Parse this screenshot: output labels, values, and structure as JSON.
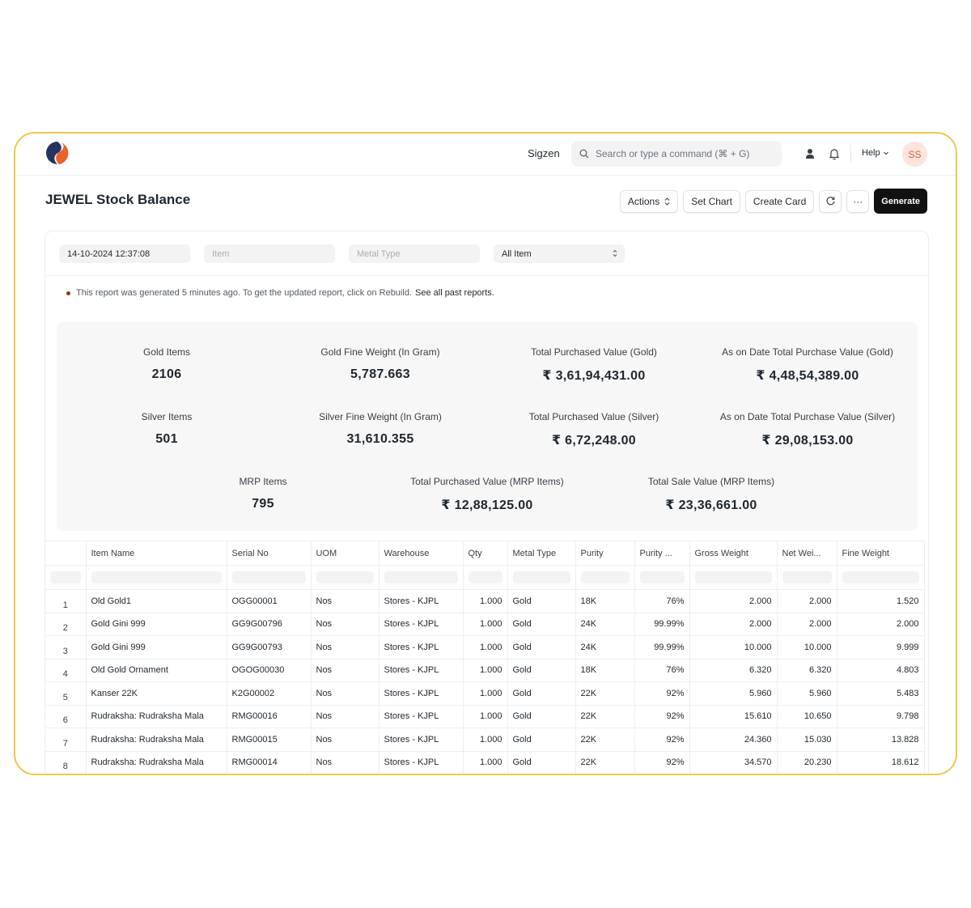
{
  "nav": {
    "brand": "Sigzen",
    "search_placeholder": "Search or type a command (⌘ + G)",
    "help": "Help",
    "avatar_initials": "SS"
  },
  "page": {
    "title": "JEWEL Stock Balance"
  },
  "toolbar": {
    "actions": "Actions",
    "set_chart": "Set Chart",
    "create_card": "Create Card",
    "more": "···",
    "generate": "Generate"
  },
  "filters": {
    "date": "14-10-2024 12:37:08",
    "item_placeholder": "Item",
    "metal_type_placeholder": "Metal Type",
    "item_scope": "All Item"
  },
  "notice": {
    "text": "This report was generated 5 minutes ago. To get the updated report, click on Rebuild.",
    "link": "See all past reports."
  },
  "summary": [
    {
      "label": "Gold Items",
      "value": "2106"
    },
    {
      "label": "Gold Fine Weight (In Gram)",
      "value": "5,787.663"
    },
    {
      "label": "Total Purchased Value (Gold)",
      "value": "₹ 3,61,94,431.00"
    },
    {
      "label": "As on Date Total Purchase Value (Gold)",
      "value": "₹ 4,48,54,389.00"
    },
    {
      "label": "Silver Items",
      "value": "501"
    },
    {
      "label": "Silver Fine Weight (In Gram)",
      "value": "31,610.355"
    },
    {
      "label": "Total Purchased Value (Silver)",
      "value": "₹ 6,72,248.00"
    },
    {
      "label": "As on Date Total Purchase Value (Silver)",
      "value": "₹ 29,08,153.00"
    },
    {
      "label": "MRP Items",
      "value": "795"
    },
    {
      "label": "Total Purchased Value (MRP Items)",
      "value": "₹ 12,88,125.00"
    },
    {
      "label": "Total Sale Value (MRP Items)",
      "value": "₹ 23,36,661.00"
    }
  ],
  "table": {
    "columns": [
      "",
      "Item Name",
      "Serial No",
      "UOM",
      "Warehouse",
      "Qty",
      "Metal Type",
      "Purity",
      "Purity ...",
      "Gross Weight",
      "Net Wei...",
      "Fine Weight"
    ],
    "rows": [
      [
        "1",
        "Old Gold1",
        "OGG00001",
        "Nos",
        "Stores - KJPL",
        "1.000",
        "Gold",
        "18K",
        "76%",
        "2.000",
        "2.000",
        "1.520"
      ],
      [
        "2",
        "Gold Gini 999",
        "GG9G00796",
        "Nos",
        "Stores - KJPL",
        "1.000",
        "Gold",
        "24K",
        "99.99%",
        "2.000",
        "2.000",
        "2.000"
      ],
      [
        "3",
        "Gold Gini 999",
        "GG9G00793",
        "Nos",
        "Stores - KJPL",
        "1.000",
        "Gold",
        "24K",
        "99.99%",
        "10.000",
        "10.000",
        "9.999"
      ],
      [
        "4",
        "Old Gold Ornament",
        "OGOG00030",
        "Nos",
        "Stores - KJPL",
        "1.000",
        "Gold",
        "18K",
        "76%",
        "6.320",
        "6.320",
        "4.803"
      ],
      [
        "5",
        "Kanser 22K",
        "K2G00002",
        "Nos",
        "Stores - KJPL",
        "1.000",
        "Gold",
        "22K",
        "92%",
        "5.960",
        "5.960",
        "5.483"
      ],
      [
        "6",
        "Rudraksha: Rudraksha Mala",
        "RMG00016",
        "Nos",
        "Stores - KJPL",
        "1.000",
        "Gold",
        "22K",
        "92%",
        "15.610",
        "10.650",
        "9.798"
      ],
      [
        "7",
        "Rudraksha: Rudraksha Mala",
        "RMG00015",
        "Nos",
        "Stores - KJPL",
        "1.000",
        "Gold",
        "22K",
        "92%",
        "24.360",
        "15.030",
        "13.828"
      ],
      [
        "8",
        "Rudraksha: Rudraksha Mala",
        "RMG00014",
        "Nos",
        "Stores - KJPL",
        "1.000",
        "Gold",
        "22K",
        "92%",
        "34.570",
        "20.230",
        "18.612"
      ]
    ]
  },
  "colors": {
    "frame_border": "#f0c54a",
    "logo_blue": "#23355f",
    "logo_orange": "#e8622a",
    "primary_button": "#111111",
    "avatar_bg": "#fde4dc"
  }
}
